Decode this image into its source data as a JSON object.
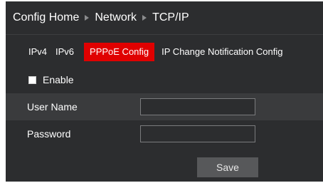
{
  "breadcrumb": {
    "items": [
      "Config Home",
      "Network",
      "TCP/IP"
    ]
  },
  "tabs": [
    {
      "label": "IPv4",
      "active": false
    },
    {
      "label": "IPv6",
      "active": false
    },
    {
      "label": "PPPoE Config",
      "active": true
    },
    {
      "label": "IP Change Notification Config",
      "active": false
    }
  ],
  "form": {
    "enable_label": "Enable",
    "enable_checked": false,
    "username_label": "User Name",
    "username_value": "",
    "password_label": "Password",
    "password_value": "",
    "save_label": "Save"
  },
  "colors": {
    "active_tab": "#e00000",
    "panel_bg": "#2c2d2f"
  }
}
